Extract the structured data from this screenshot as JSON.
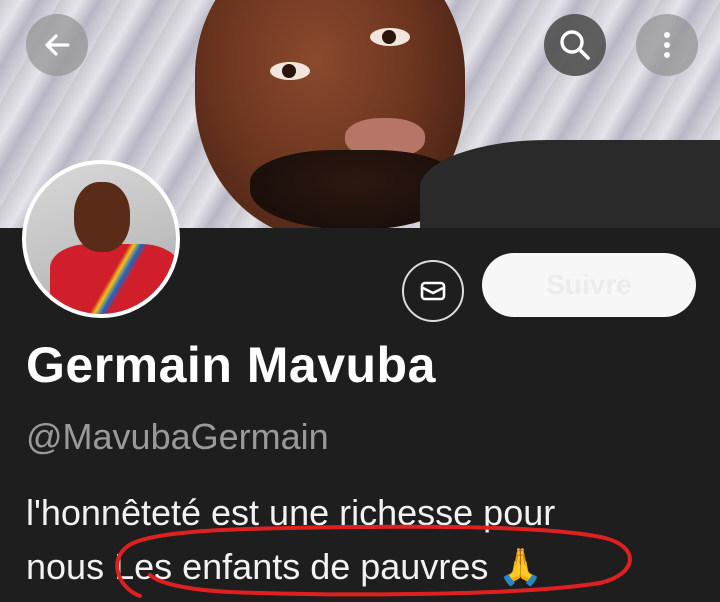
{
  "header": {
    "back_icon": "arrow-left-icon",
    "search_icon": "search-icon",
    "more_icon": "more-vertical-icon"
  },
  "profile": {
    "name": "Germain Mavuba",
    "handle": "@MavubaGermain",
    "bio_line1": "l'honnêteté est une richesse pour",
    "bio_line2_prefix": "nous ",
    "bio_line2_highlight": "Les enfants de pauvres",
    "bio_emoji": "🙏"
  },
  "actions": {
    "message_icon": "mail-icon",
    "follow_label": "Suivre"
  },
  "colors": {
    "background": "#1e1e1e",
    "name": "#ffffff",
    "handle": "#9a9a9a",
    "annotation": "#e02020"
  }
}
